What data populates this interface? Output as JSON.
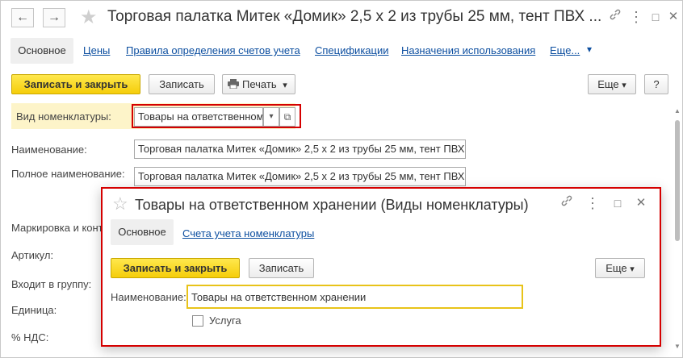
{
  "window": {
    "title": "Торговая палатка Митек «Домик» 2,5 х 2 из трубы 25 мм, тент ПВХ ...",
    "back_icon": "←",
    "forward_icon": "→",
    "star_icon": "★",
    "link_icon": "🔗",
    "more_icon": "⋮",
    "maximize_icon": "□",
    "close_icon": "✕"
  },
  "tabs": {
    "active": "Основное",
    "links": [
      "Цены",
      "Правила определения счетов учета",
      "Спецификации",
      "Назначения использования",
      "Еще..."
    ],
    "more_arrow": "▾"
  },
  "toolbar": {
    "save_close": "Записать и закрыть",
    "save": "Записать",
    "print": "Печать",
    "print_arrow": "▾",
    "more": "Еще",
    "more_arrow": "▾",
    "help": "?"
  },
  "form": {
    "vid_label": "Вид номенклатуры:",
    "vid_value": "Товары на ответственном",
    "vid_dropdown": "▾",
    "vid_open": "⧉",
    "name_label": "Наименование:",
    "name_value": "Торговая палатка Митек «Домик» 2,5 х 2 из трубы 25 мм, тент ПВХ",
    "fullname_label": "Полное наименование:",
    "fullname_value": "Торговая палатка Митек «Домик» 2,5 х 2 из трубы 25 мм, тент ПВХ",
    "marking_label": "Маркировка и конт",
    "article_label": "Артикул:",
    "group_label": "Входит в группу:",
    "unit_label": "Единица:",
    "vat_label": "% НДС:"
  },
  "dialog": {
    "star_icon": "☆",
    "title": "Товары на ответственном хранении (Виды номенклатуры)",
    "link_icon": "🔗",
    "more_icon": "⋮",
    "maximize_icon": "□",
    "close_icon": "✕",
    "tab_active": "Основное",
    "tab_link": "Счета учета номенклатуры",
    "save_close": "Записать и закрыть",
    "save": "Записать",
    "more": "Еще",
    "more_arrow": "▾",
    "name_label": "Наименование:",
    "name_value": "Товары на ответственном хранении",
    "service_label": "Услуга",
    "service_checked": false
  },
  "colors": {
    "accent_yellow": "#f5cd0a",
    "highlight_red": "#d50000",
    "link_blue": "#0d4fa0"
  }
}
